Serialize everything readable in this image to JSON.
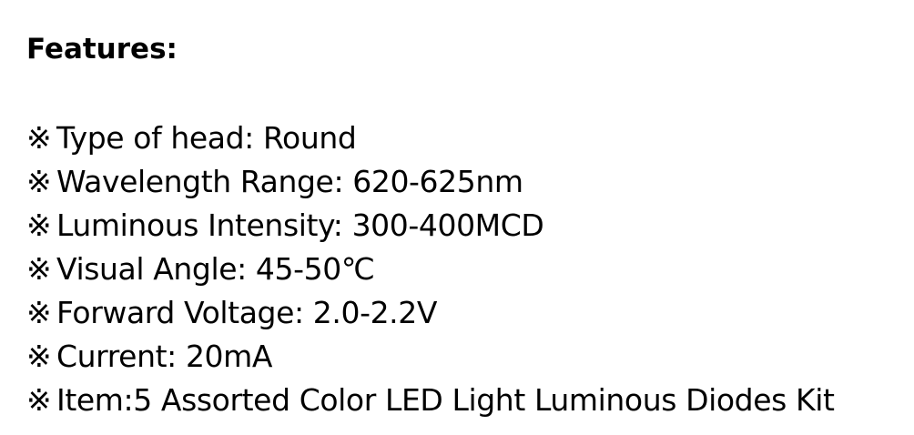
{
  "heading": "Features:",
  "bullet_mark": "※",
  "features": [
    {
      "text": "Type of head: Round"
    },
    {
      "text": "Wavelength Range: 620-625nm"
    },
    {
      "text": "Luminous Intensity: 300-400MCD"
    },
    {
      "text": "Visual Angle: 45-50℃"
    },
    {
      "text": "Forward Voltage: 2.0-2.2V"
    },
    {
      "text": "Current: 20mA"
    },
    {
      "text": "Item:5 Assorted Color LED Light Luminous Diodes Kit"
    }
  ]
}
